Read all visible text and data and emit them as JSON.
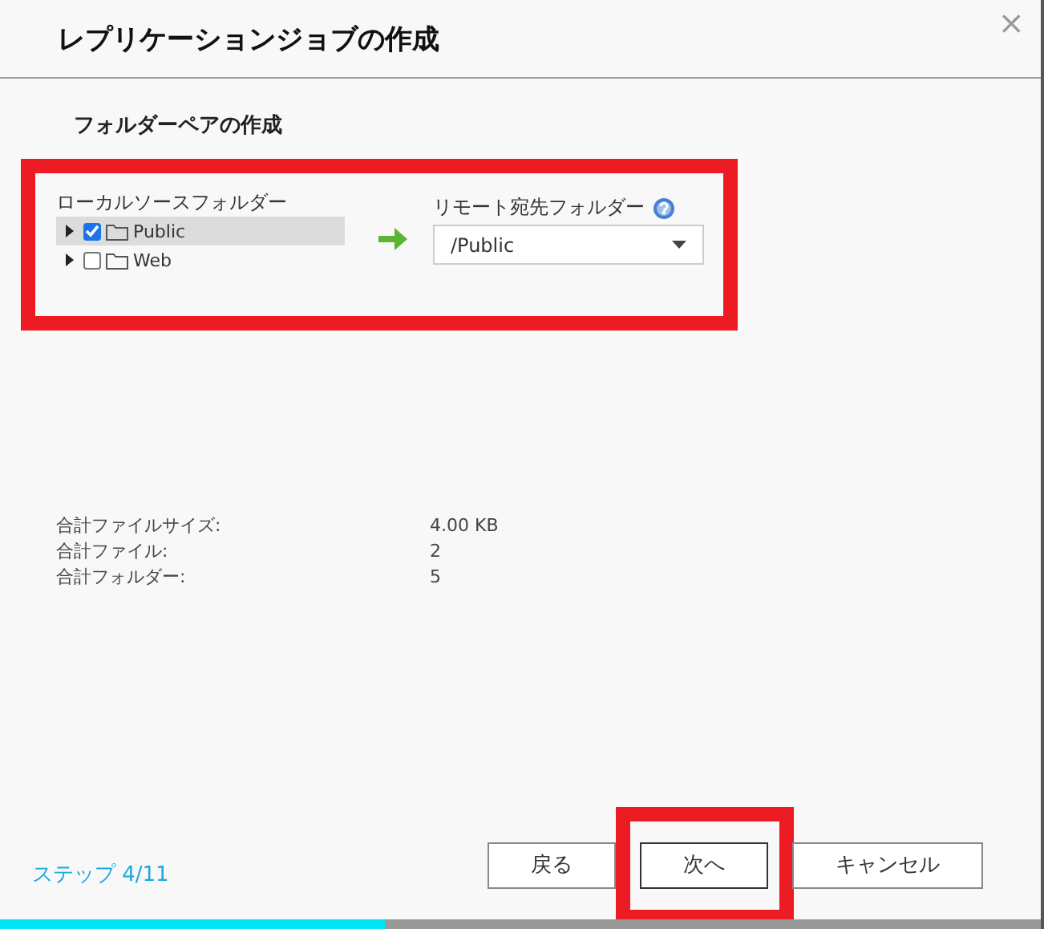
{
  "window": {
    "title": "レプリケーションジョブの作成",
    "close": "×"
  },
  "section_title": "フォルダーペアの作成",
  "folder_pair": {
    "highlighted": true,
    "local": {
      "label": "ローカルソースフォルダー",
      "tree": [
        {
          "name": "Public",
          "checked": true,
          "selected": true
        },
        {
          "name": "Web",
          "checked": false,
          "selected": false
        }
      ]
    },
    "remote": {
      "label": "リモート宛先フォルダー",
      "value": "/Public"
    }
  },
  "summary": [
    {
      "label": "合計ファイルサイズ:",
      "value": "4.00 KB"
    },
    {
      "label": "合計ファイル:",
      "value": "2"
    },
    {
      "label": "合計フォルダー:",
      "value": "5"
    }
  ],
  "step": "ステップ 4/11",
  "buttons": [
    {
      "label": "戻る",
      "highlighted": false
    },
    {
      "label": "次へ",
      "highlighted": true
    },
    {
      "label": "キャンセル",
      "highlighted": false
    }
  ],
  "progress": {
    "level": 0.37
  }
}
